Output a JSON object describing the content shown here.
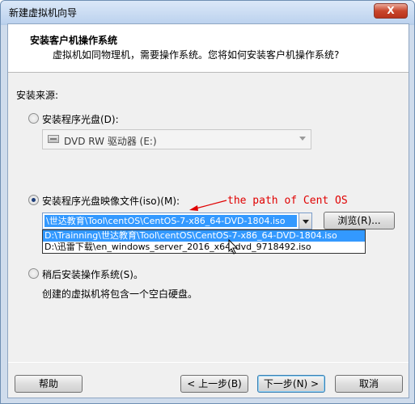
{
  "window": {
    "title": "新建虚拟机向导",
    "close_label": "X"
  },
  "header": {
    "title": "安装客户机操作系统",
    "subtitle": "虚拟机如同物理机，需要操作系统。您将如何安装客户机操作系统?"
  },
  "source": {
    "label": "安装来源:",
    "disc_option": {
      "label": "安装程序光盘(D):",
      "checked": false
    },
    "disc_drive": "DVD RW 驱动器 (E:)",
    "iso_option": {
      "label": "安装程序光盘映像文件(iso)(M):",
      "checked": true
    },
    "iso_value": "\\世达教育\\Tool\\centOS\\CentOS-7-x86_64-DVD-1804.iso",
    "browse_label": "浏览(R)...",
    "dropdown_items": [
      "D:\\Trainning\\世达教育\\Tool\\centOS\\CentOS-7-x86_64-DVD-1804.iso",
      "D:\\迅雷下载\\en_windows_server_2016_x64_dvd_9718492.iso"
    ],
    "later_option": {
      "label": "稍后安装操作系统(S)。",
      "checked": false
    },
    "later_desc": "创建的虚拟机将包含一个空白硬盘。"
  },
  "annotation": {
    "text": "the path of Cent OS",
    "color": "#e00000"
  },
  "footer": {
    "help_label": "帮助",
    "back_label": "< 上一步(B)",
    "next_label": "下一步(N) >",
    "cancel_label": "取消"
  }
}
